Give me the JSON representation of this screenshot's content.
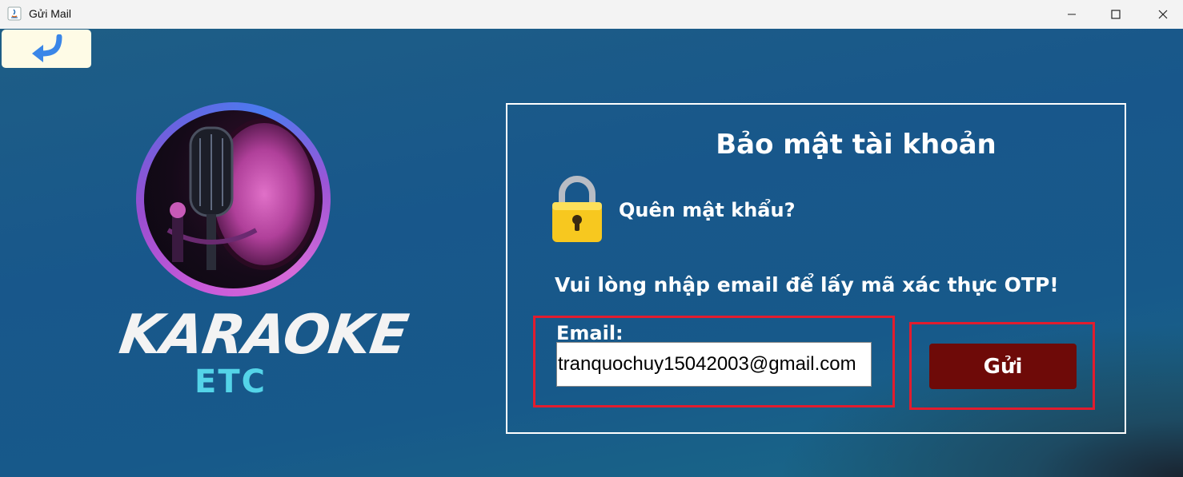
{
  "window": {
    "title": "Gửi Mail",
    "controls": [
      "minimize-icon",
      "maximize-icon",
      "close-icon"
    ]
  },
  "back_button": {
    "icon": "back-arrow-icon"
  },
  "logo": {
    "title": "KARAOKE",
    "subtitle": "ETC",
    "image": "microphone-icon"
  },
  "panel": {
    "title": "Bảo mật tài khoản",
    "lock_icon": "lock-icon",
    "forgot_text": "Quên mật khẩu?",
    "instruction": "Vui lòng nhập email để lấy mã xác thực OTP!",
    "email_label": "Email:",
    "email_value": "tranquochuy15042003@gmail.com",
    "send_label": "Gửi"
  },
  "colors": {
    "background": "#18578b",
    "send_button": "#6e0a08",
    "highlight_border": "#e21c2e",
    "back_button_bg": "#fefbe6",
    "subtitle": "#54d4e8"
  }
}
